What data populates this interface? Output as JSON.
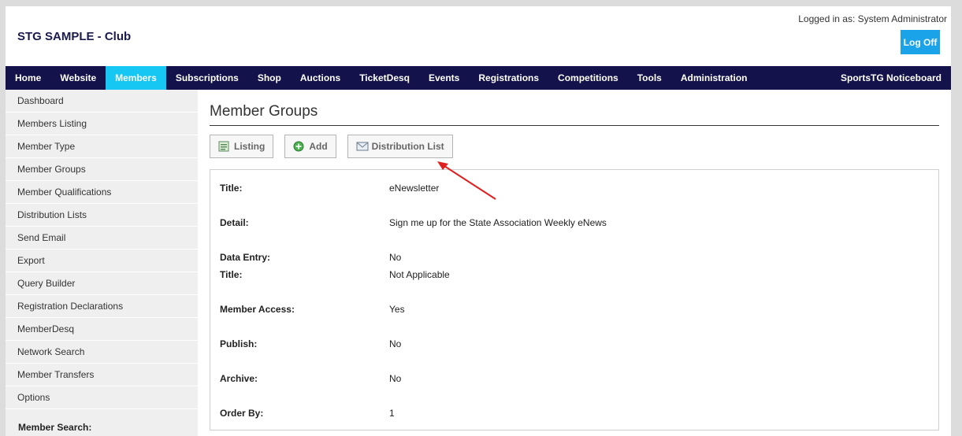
{
  "header": {
    "club_title": "STG SAMPLE - Club",
    "logged_in": "Logged in as: System Administrator",
    "logoff_label": "Log Off"
  },
  "topnav": {
    "items": [
      "Home",
      "Website",
      "Members",
      "Subscriptions",
      "Shop",
      "Auctions",
      "TicketDesq",
      "Events",
      "Registrations",
      "Competitions",
      "Tools",
      "Administration"
    ],
    "active": "Members",
    "right": "SportsTG Noticeboard"
  },
  "sidebar": {
    "items": [
      "Dashboard",
      "Members Listing",
      "Member Type",
      "Member Groups",
      "Member Qualifications",
      "Distribution Lists",
      "Send Email",
      "Export",
      "Query Builder",
      "Registration Declarations",
      "MemberDesq",
      "Network Search",
      "Member Transfers",
      "Options"
    ],
    "search_label": "Member Search:"
  },
  "main": {
    "title": "Member Groups",
    "buttons": {
      "listing": "Listing",
      "add": "Add",
      "distribution": "Distribution List"
    },
    "fields": [
      {
        "label": "Title:",
        "value": "eNewsletter"
      },
      {
        "label": "Detail:",
        "value": "Sign me up for the State Association Weekly eNews"
      },
      {
        "label": "Data Entry:",
        "value": "No"
      },
      {
        "label": "Title:",
        "value": "Not Applicable"
      },
      {
        "label": "Member Access:",
        "value": "Yes"
      },
      {
        "label": "Publish:",
        "value": "No"
      },
      {
        "label": "Archive:",
        "value": "No"
      },
      {
        "label": "Order By:",
        "value": "1"
      }
    ]
  },
  "colors": {
    "nav_bg": "#13124a",
    "nav_active": "#16c7f3",
    "logoff_bg": "#1aa3e8",
    "annotation_arrow": "#e02020"
  },
  "icons": {
    "listing": "listing-icon",
    "add": "add-icon",
    "distribution": "envelope-icon"
  }
}
